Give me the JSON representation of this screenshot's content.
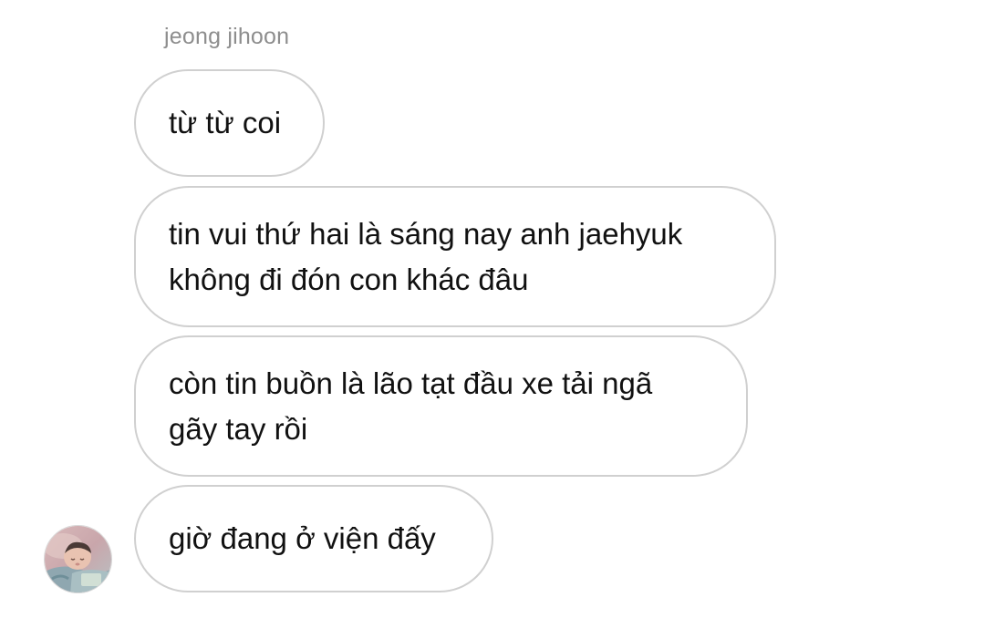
{
  "conversation": {
    "sender_name": "jeong jihoon",
    "messages": [
      {
        "text": "từ từ coi"
      },
      {
        "text": "tin vui thứ hai là sáng nay anh jaehyuk\nkhông đi đón con khác đâu"
      },
      {
        "text": "còn tin buồn là lão tạt đầu xe tải ngã\ngãy tay rồi"
      },
      {
        "text": "giờ đang ở viện đấy"
      }
    ],
    "avatar": {
      "icon": "baby-photo-avatar"
    }
  },
  "colors": {
    "background": "#ffffff",
    "bubble_border": "#d0d0d0",
    "message_text": "#111111",
    "sender_name_text": "#8e8e8e"
  }
}
